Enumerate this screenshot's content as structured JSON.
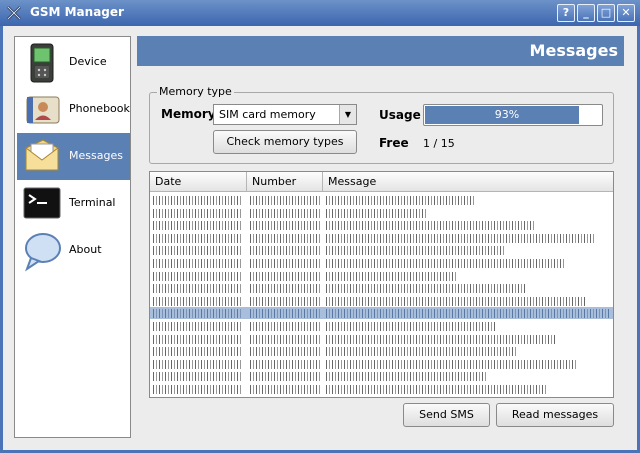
{
  "window": {
    "title": "GSM Manager",
    "controls": {
      "help": "?",
      "minimize": "_",
      "maximize": "□",
      "close": "✕"
    }
  },
  "sidebar": {
    "items": [
      {
        "label": "Device",
        "icon": "device-icon",
        "active": false
      },
      {
        "label": "Phonebook",
        "icon": "phonebook-icon",
        "active": false
      },
      {
        "label": "Messages",
        "icon": "messages-icon",
        "active": true
      },
      {
        "label": "Terminal",
        "icon": "terminal-icon",
        "active": false
      },
      {
        "label": "About",
        "icon": "about-icon",
        "active": false
      }
    ]
  },
  "header": {
    "title": "Messages"
  },
  "memory": {
    "group_label": "Memory type",
    "memory_label": "Memory",
    "selected": "SIM card memory",
    "check_button": "Check memory types",
    "usage_label": "Usage",
    "usage_percent": 93,
    "usage_text": "93%",
    "free_label": "Free",
    "free_value": "1  /  15"
  },
  "table": {
    "columns": [
      "Date",
      "Number",
      "Message"
    ],
    "row_count": 16,
    "selected_row": 9
  },
  "actions": {
    "send": "Send SMS",
    "read": "Read messages"
  },
  "colors": {
    "accent": "#5b80b4",
    "title_bar": "#3c66ae",
    "selection": "#a9bedb"
  }
}
